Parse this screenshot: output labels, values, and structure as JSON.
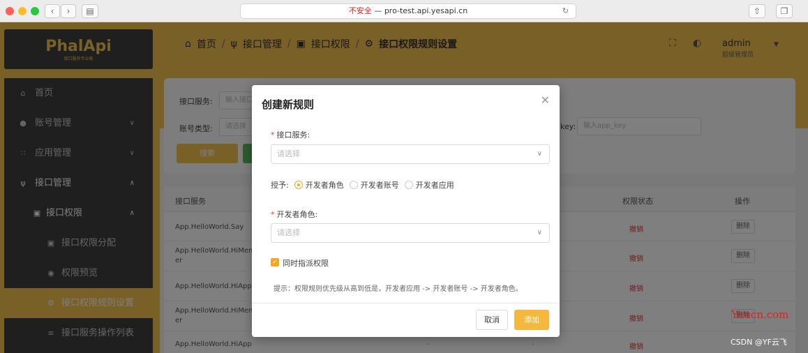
{
  "browser": {
    "insecure_label": "不安全",
    "url_sep": " — ",
    "domain": "pro-test.api.yesapi.cn"
  },
  "colors": {
    "brand": "#f1c04f",
    "sidebar_bg": "#3e3e3e",
    "danger": "#e23b3b",
    "radio_accent": "#f1a824"
  },
  "logo": {
    "text": "PhalApi",
    "tagline": "接口服务专业版"
  },
  "sidebar": {
    "items": [
      {
        "icon": "home-icon",
        "label": "首页"
      },
      {
        "icon": "user-icon",
        "label": "账号管理"
      },
      {
        "icon": "grid-icon",
        "label": "应用管理"
      },
      {
        "icon": "api-icon",
        "label": "接口管理"
      },
      {
        "icon": "lock-icon",
        "label": "接口权限"
      },
      {
        "icon": "lock-icon",
        "label": "接口权限分配"
      },
      {
        "icon": "eye-icon",
        "label": "权限预览"
      },
      {
        "icon": "gear-icon",
        "label": "接口权限规则设置"
      },
      {
        "icon": "list-icon",
        "label": "接口服务操作列表"
      }
    ]
  },
  "header": {
    "breadcrumb": [
      "首页",
      "接口管理",
      "接口权限",
      "接口权限规则设置"
    ],
    "separator": "/",
    "user": {
      "name": "admin",
      "role": "超级管理员"
    }
  },
  "search": {
    "service_label": "接口服务:",
    "service_placeholder": "输入接口",
    "account_type_label": "账号类型:",
    "account_type_placeholder": "请选择",
    "appkey_label": "key:",
    "appkey_placeholder": "输入app_key",
    "search_btn": "搜索"
  },
  "table": {
    "columns": [
      "接口服务",
      "权限状态",
      "操作"
    ],
    "rows": [
      {
        "service": "App.HelloWorld.Say",
        "status": "撤销",
        "action": "删除"
      },
      {
        "service": "App.HelloWorld.HiMemb",
        "service2": "er",
        "status": "撤销",
        "action": "删除"
      },
      {
        "service": "App.HelloWorld.HiApp",
        "status": "撤销",
        "action": "删除"
      },
      {
        "service": "App.HelloWorld.HiMemb",
        "service2": "er",
        "status": "撤销",
        "action": "删除"
      },
      {
        "service": "App.HelloWorld.HiApp",
        "status": "撤销",
        "dash1": "-",
        "dash2": "-"
      }
    ]
  },
  "modal": {
    "title": "创建新规则",
    "service_label": "接口服务:",
    "service_placeholder": "请选择",
    "grant_label": "授予:",
    "grant_options": [
      "开发者角色",
      "开发者账号",
      "开发者应用"
    ],
    "grant_selected": "开发者角色",
    "role_label": "开发者角色:",
    "role_placeholder": "请选择",
    "sync_label": "同时指派权限",
    "sync_checked": true,
    "hint": "提示：权限规则优先级从高到低是，开发者应用 -> 开发者账号 -> 开发者角色。",
    "cancel": "取消",
    "add": "添加"
  },
  "watermarks": {
    "site": "Yuucn.com",
    "csdn": "CSDN @YF云飞"
  }
}
